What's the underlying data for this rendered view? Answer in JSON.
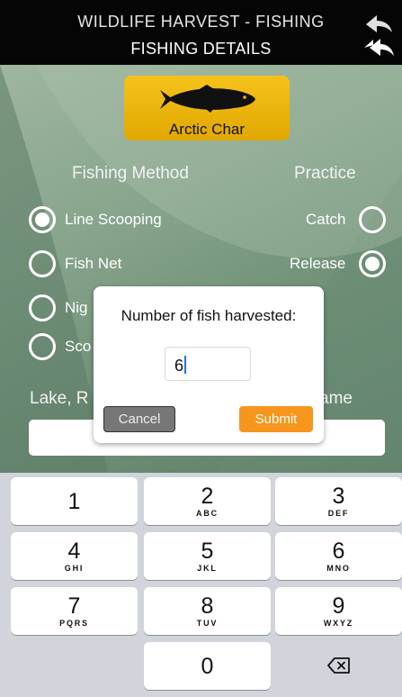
{
  "header": {
    "subtitle": "WILDLIFE HARVEST - FISHING",
    "title": "FISHING DETAILS"
  },
  "species": {
    "name": "Arctic Char",
    "icon": "fish-icon",
    "color": "#f0b80e"
  },
  "fishing_method": {
    "label": "Fishing Method",
    "options": [
      {
        "label": "Line Scooping",
        "selected": true
      },
      {
        "label": "Fish Net",
        "selected": false
      },
      {
        "label": "Nig",
        "selected": false
      },
      {
        "label": "Sco",
        "selected": false
      }
    ]
  },
  "practice": {
    "label": "Practice",
    "options": [
      {
        "label": "Catch",
        "selected": false
      },
      {
        "label": "Release",
        "selected": true
      }
    ]
  },
  "location": {
    "label_visible": "Lake, R",
    "label_tail": "ame",
    "value": ""
  },
  "dialog": {
    "title": "Number of fish harvested:",
    "input_value": "6",
    "cancel_label": "Cancel",
    "submit_label": "Submit",
    "submit_color": "#f7961c"
  },
  "keypad": {
    "keys": [
      {
        "num": "1",
        "letters": ""
      },
      {
        "num": "2",
        "letters": "ABC"
      },
      {
        "num": "3",
        "letters": "DEF"
      },
      {
        "num": "4",
        "letters": "GHI"
      },
      {
        "num": "5",
        "letters": "JKL"
      },
      {
        "num": "6",
        "letters": "MNO"
      },
      {
        "num": "7",
        "letters": "PQRS"
      },
      {
        "num": "8",
        "letters": "TUV"
      },
      {
        "num": "9",
        "letters": "WXYZ"
      },
      {
        "num": "0",
        "letters": ""
      }
    ],
    "delete_icon": "backspace-icon"
  }
}
